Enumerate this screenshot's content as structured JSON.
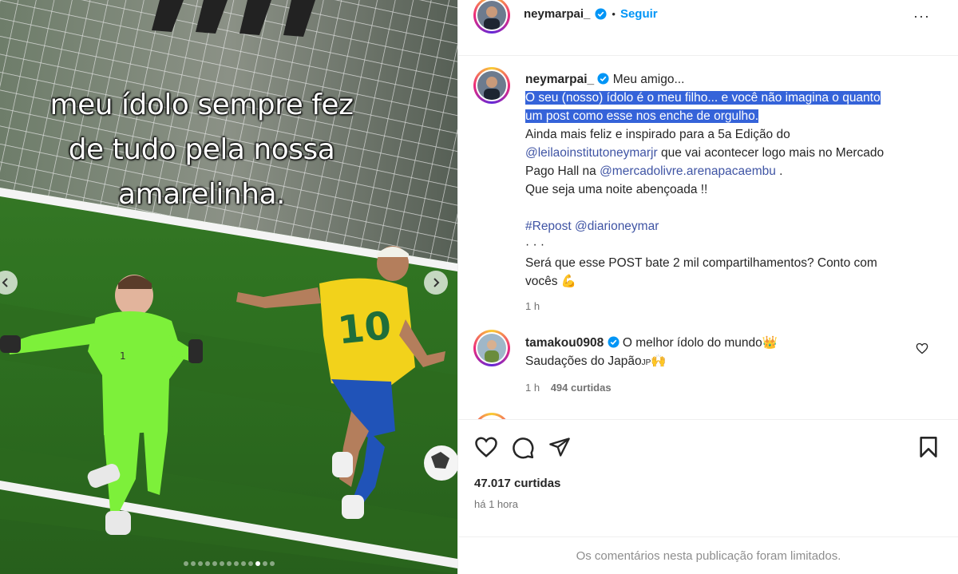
{
  "post": {
    "overlay_lines": [
      "meu ídolo sempre fez",
      "de tudo pela nossa",
      "amarelinha."
    ],
    "player_numbers": {
      "keeper": "1",
      "striker": "10"
    },
    "carousel_dot_count": 13,
    "carousel_active_index": 10
  },
  "header": {
    "username": "neymarpai_",
    "separator": "•",
    "follow_label": "Seguir",
    "more_label": "···"
  },
  "caption": {
    "username": "neymarpai_",
    "first_line": "Meu amigo...",
    "highlight_lines": [
      "O seu (nosso) ídolo é o meu filho... e você não imagina o quanto",
      "um post como esse nos enche de orgulho."
    ],
    "line_a": "Ainda mais feliz e inspirado para a 5a Edição do",
    "mention_1": "@leilaoinstitutoneymarjr",
    "line_b_rest": " que vai acontecer logo mais no Mercado",
    "line_c_start": "Pago Hall na ",
    "mention_2": "@mercadolivre.arenapacaembu",
    "line_c_end": " .",
    "line_d": "Que seja uma noite abençoada !!",
    "hashtag": "#Repost",
    "mention_3": "@diarioneymar",
    "dots_line": "·  ·  ·",
    "question_1": "Será que esse POST bate 2 mil compartilhamentos? Conto com",
    "question_2": "vocês",
    "emoji_flex": "💪",
    "time": "1 h"
  },
  "comment": {
    "username": "tamakou0908",
    "text_1": "O melhor ídolo do mundo",
    "emoji_crown": "👑",
    "text_2": "Saudações do Japão",
    "flag_text": "JP",
    "emoji_hands": "🙌",
    "time": "1 h",
    "likes": "494 curtidas"
  },
  "footer": {
    "likes": "47.017 curtidas",
    "time": "há 1 hora",
    "limited_notice": "Os comentários nesta publicação foram limitados."
  },
  "colors": {
    "accent_blue": "#0095f6",
    "verified_blue": "#0095f6",
    "highlight": "#3563d9",
    "brazil_yellow": "#f2d21b",
    "keeper_green": "#7df03a"
  }
}
